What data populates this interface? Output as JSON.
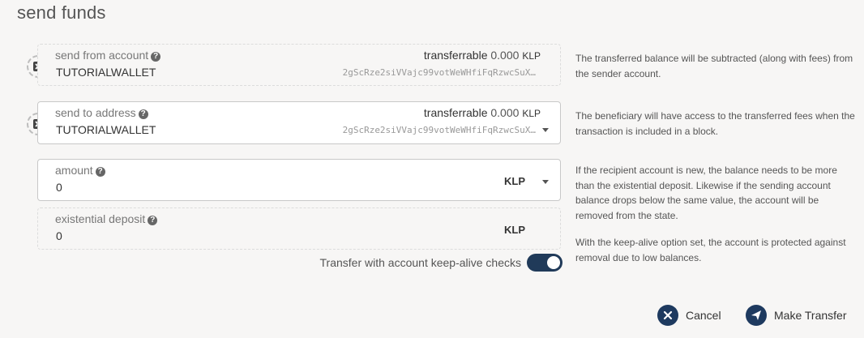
{
  "title": "send funds",
  "from": {
    "label": "send from account",
    "help": "?",
    "account_name": "TUTORIALWALLET",
    "transferrable_label": "transferrable",
    "transferrable_value": "0.000",
    "unit": "KLP",
    "address": "2gScRze2siVVajc99votWeWHfiFqRzwcSuX…",
    "hint": "The transferred balance will be subtracted (along with fees) from the sender account."
  },
  "to": {
    "label": "send to address",
    "help": "?",
    "account_name": "TUTORIALWALLET",
    "transferrable_label": "transferrable",
    "transferrable_value": "0.000",
    "unit": "KLP",
    "address": "2gScRze2siVVajc99votWeWHfiFqRzwcSuX…",
    "hint": "The beneficiary will have access to the transferred fees when the transaction is included in a block."
  },
  "amount": {
    "label": "amount",
    "help": "?",
    "value": "0",
    "unit": "KLP",
    "hint": "If the recipient account is new, the balance needs to be more than the existential deposit. Likewise if the sending account balance drops below the same value, the account will be removed from the state."
  },
  "existential": {
    "label": "existential deposit",
    "help": "?",
    "value": "0",
    "unit": "KLP"
  },
  "keepalive": {
    "label": "Transfer with account keep-alive checks",
    "enabled": true,
    "hint": "With the keep-alive option set, the account is protected against removal due to low balances."
  },
  "buttons": {
    "cancel": "Cancel",
    "submit": "Make Transfer"
  },
  "colors": {
    "accent": "#1e3a5f",
    "background": "#f7f6f5"
  }
}
